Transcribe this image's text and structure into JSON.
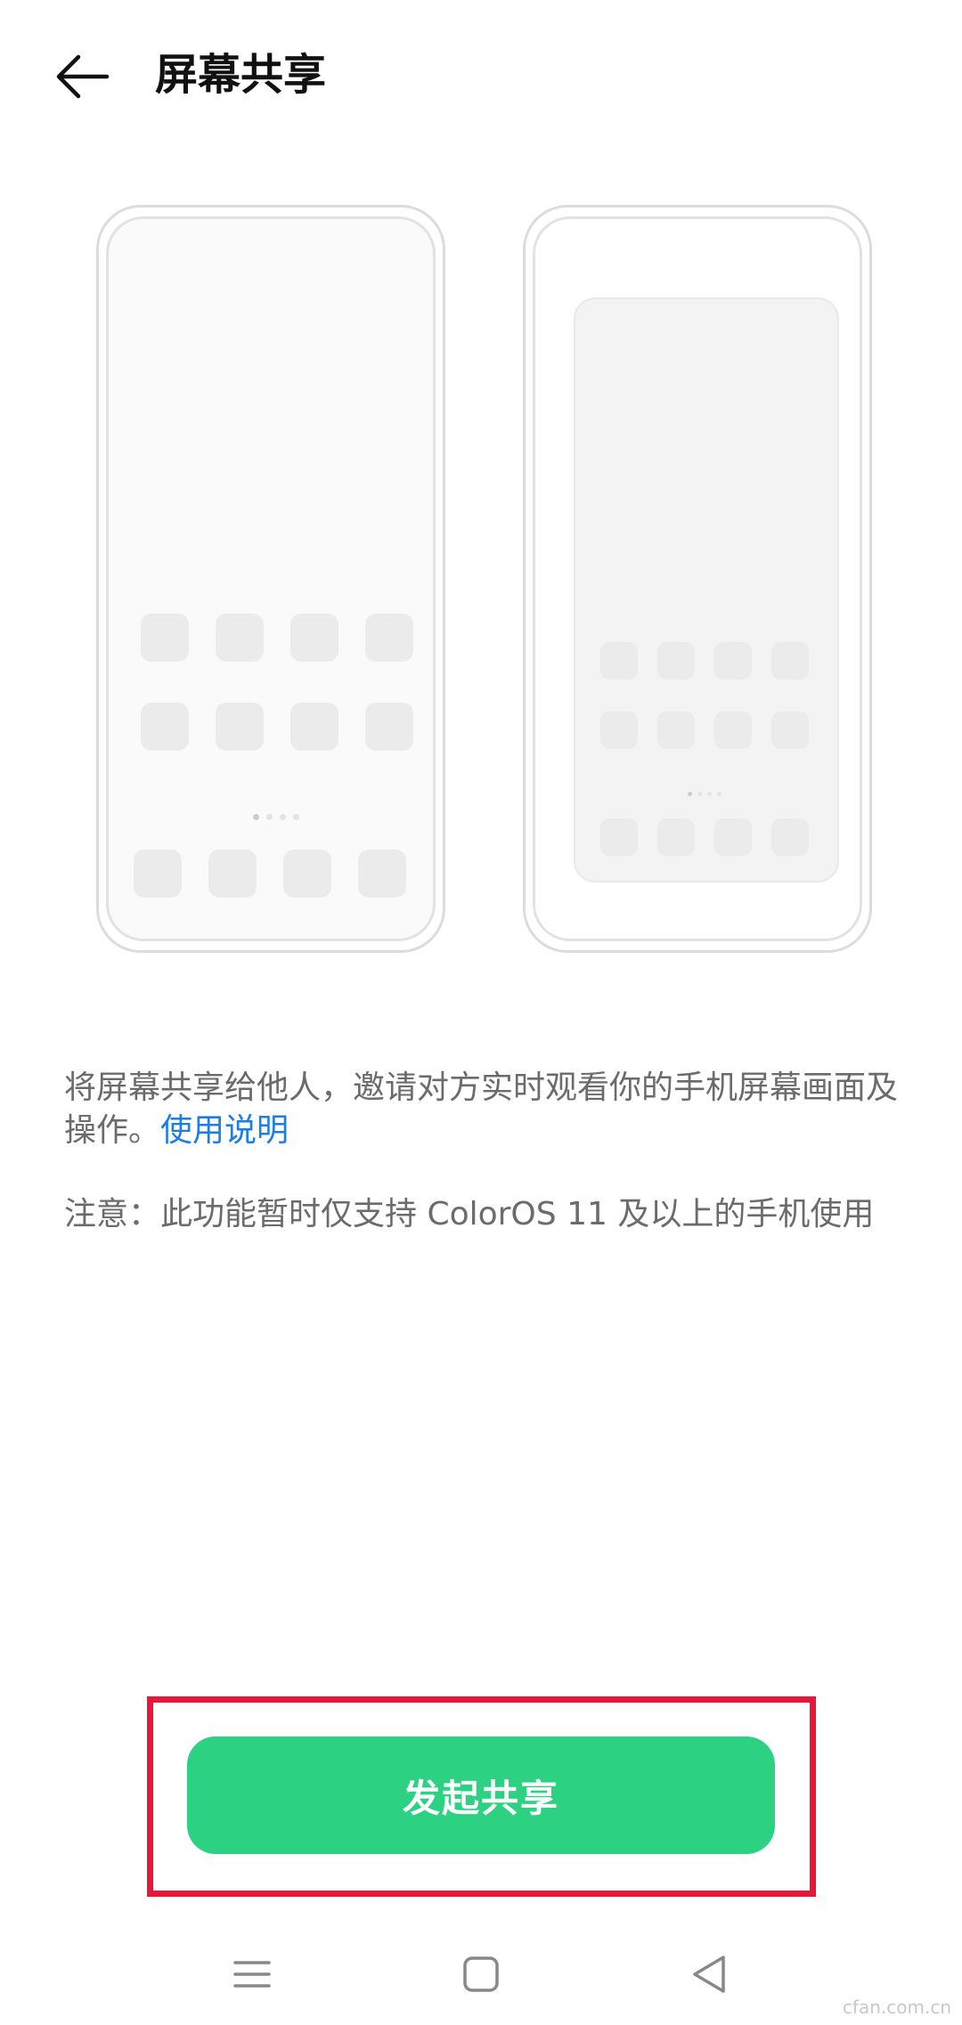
{
  "header": {
    "title": "屏幕共享",
    "back_icon": "arrow-left-icon"
  },
  "illustration": {
    "left_phone": "home-screen-phone",
    "right_phone": "shared-screen-phone"
  },
  "description": {
    "text": "将屏幕共享给他人，邀请对方实时观看你的手机屏幕画面及操作。",
    "link": "使用说明",
    "link_color": "#1a7ee6"
  },
  "notice": "注意：此功能暂时仅支持 ColorOS 11 及以上的手机使用",
  "action": {
    "start_share_label": "发起共享",
    "button_color": "#2dd182",
    "highlight_color": "#e8173a"
  },
  "navbar": {
    "menu_icon": "menu-icon",
    "home_icon": "home-square-icon",
    "back_icon": "back-triangle-icon"
  },
  "watermark": "cfan.com.cn"
}
